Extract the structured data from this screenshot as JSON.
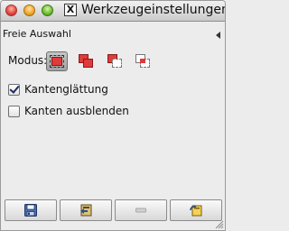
{
  "window": {
    "title": "Werkzeugeinstellungen",
    "x11_glyph": "X"
  },
  "tool": {
    "name": "Freie Auswahl"
  },
  "mode": {
    "label": "Modus:",
    "options": [
      {
        "icon": "replace-selection-icon",
        "active": true
      },
      {
        "icon": "add-selection-icon",
        "active": false
      },
      {
        "icon": "subtract-selection-icon",
        "active": false
      },
      {
        "icon": "intersect-selection-icon",
        "active": false
      }
    ]
  },
  "options": {
    "antialias": {
      "label": "Kantenglättung",
      "checked": true
    },
    "feather": {
      "label": "Kanten ausblenden",
      "checked": false
    }
  },
  "buttons": [
    {
      "icon": "save-icon",
      "enabled": true
    },
    {
      "icon": "restore-icon",
      "enabled": true
    },
    {
      "icon": "delete-icon",
      "enabled": false
    },
    {
      "icon": "reset-icon",
      "enabled": true
    }
  ],
  "colors": {
    "selection_red": "#e03a3a",
    "background": "#ececec"
  }
}
